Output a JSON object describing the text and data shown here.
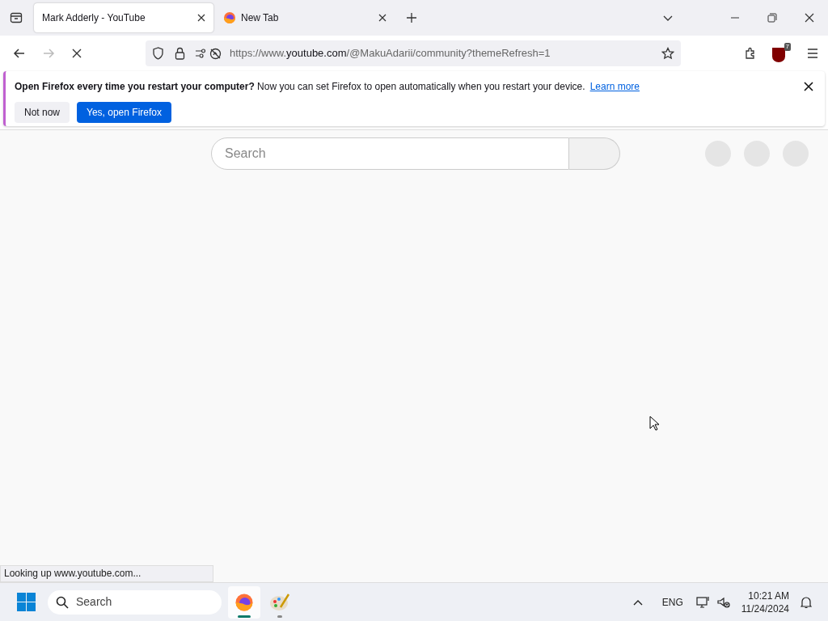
{
  "tabs": [
    {
      "title": "Mark Adderly - YouTube",
      "selected": true,
      "kind": "plain"
    },
    {
      "title": "New Tab",
      "selected": false,
      "kind": "firefox"
    }
  ],
  "address_bar": {
    "url_prefix": "https://www.",
    "url_domain": "youtube.com",
    "url_path": "/@MakuAdarii/community?themeRefresh=1"
  },
  "extension_badge": "7",
  "notification": {
    "message": "**Open Firefox every time you restart your computer?** Now you can set Firefox to open automatically when you restart your device.",
    "link": "Learn more",
    "buttons": [
      {
        "label": "Not now",
        "kind": "secondary"
      },
      {
        "label": "Yes, open Firefox",
        "kind": "primary"
      }
    ]
  },
  "page": {
    "search": {
      "placeholder": "Search"
    }
  },
  "status_text": "Looking up www.youtube.com...",
  "taskbar": {
    "search": {
      "placeholder": "Search"
    },
    "apps": [
      {
        "kind": "firefox",
        "selected": true
      },
      {
        "kind": "paint",
        "selected": false
      }
    ],
    "language": "ENG",
    "time": "10:21 AM",
    "date": "11/24/2024"
  }
}
